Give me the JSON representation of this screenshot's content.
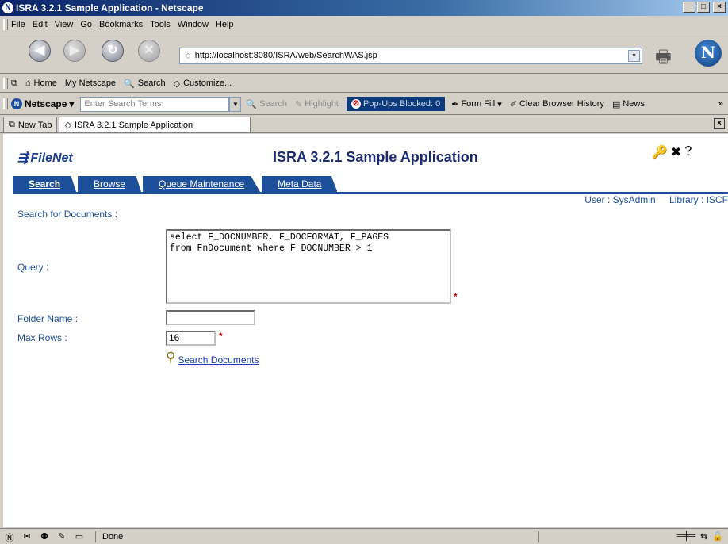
{
  "window": {
    "title": "ISRA 3.2.1 Sample Application - Netscape",
    "min": "_",
    "max": "□",
    "close": "×"
  },
  "menu": [
    "File",
    "Edit",
    "View",
    "Go",
    "Bookmarks",
    "Tools",
    "Window",
    "Help"
  ],
  "nav": {
    "back": "◀",
    "forward": "▶",
    "reload": "↻",
    "stop": "✕",
    "url": "http://localhost:8080/ISRA/web/SearchWAS.jsp",
    "logo": "N"
  },
  "personal_toolbar": {
    "items": [
      "Home",
      "My Netscape",
      "Search",
      "Customize..."
    ]
  },
  "search_toolbar": {
    "brand": "Netscape",
    "placeholder": "Enter Search Terms",
    "search": "Search",
    "highlight": "Highlight",
    "popups": "Pop-Ups Blocked: 0",
    "formfill": "Form Fill",
    "clear_history": "Clear Browser History",
    "news": "News",
    "more": "»"
  },
  "tabs": {
    "new_tab": "New Tab",
    "active": "ISRA 3.2.1 Sample Application"
  },
  "app": {
    "logo": "FileNet",
    "title": "ISRA 3.2.1 Sample Application",
    "tabs": [
      "Search",
      "Browse",
      "Queue Maintenance",
      "Meta Data"
    ],
    "user": "User : SysAdmin",
    "library": "Library : ISCF",
    "search_heading": "Search for Documents :",
    "query_label": "Query :",
    "query": "select F_DOCNUMBER, F_DOCFORMAT, F_PAGES\nfrom FnDocument where F_DOCNUMBER > 1",
    "required": "*",
    "folder_label": "Folder Name :",
    "folder_value": "",
    "maxrows_label": "Max Rows :",
    "maxrows_value": "16",
    "search_link": "Search Documents"
  },
  "status": {
    "text": "Done"
  }
}
